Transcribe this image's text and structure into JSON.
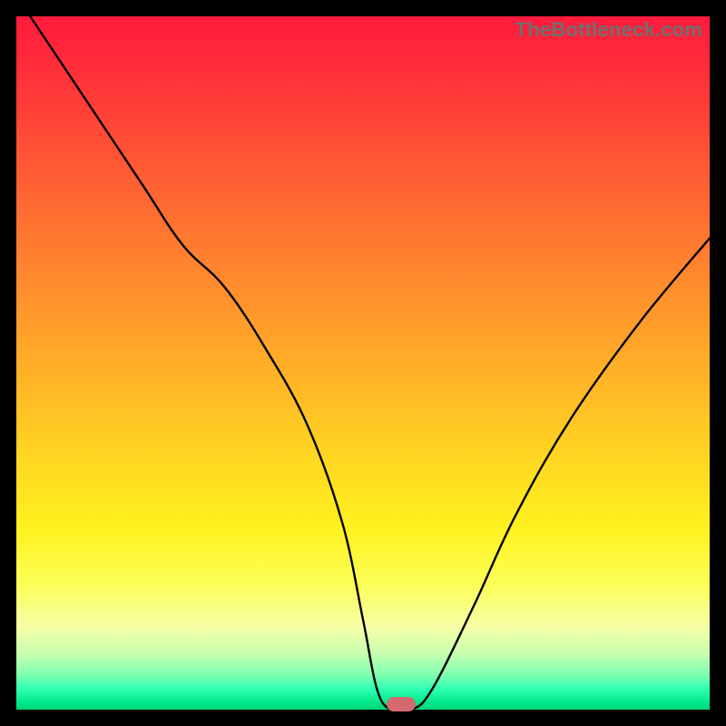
{
  "watermark": "TheBottleneck.com",
  "chart_data": {
    "type": "line",
    "title": "",
    "xlabel": "",
    "ylabel": "",
    "xlim": [
      0,
      100
    ],
    "ylim": [
      0,
      100
    ],
    "series": [
      {
        "name": "bottleneck-curve",
        "x": [
          2,
          10,
          18,
          24,
          30,
          36,
          42,
          47,
          50,
          52,
          54,
          57,
          60,
          66,
          72,
          80,
          90,
          100
        ],
        "values": [
          100,
          88,
          76,
          67,
          61,
          52,
          41,
          27,
          13,
          3,
          0,
          0,
          3,
          15,
          28,
          42,
          56,
          68
        ]
      }
    ],
    "annotations": [
      {
        "name": "optimal-marker",
        "x": 55.5,
        "y": 0
      }
    ],
    "gradient_stops": [
      {
        "pos": 0,
        "color": "#ff1a3c"
      },
      {
        "pos": 22,
        "color": "#ff5a34"
      },
      {
        "pos": 52,
        "color": "#ffb327"
      },
      {
        "pos": 74,
        "color": "#fff21f"
      },
      {
        "pos": 92,
        "color": "#c7ffb0"
      },
      {
        "pos": 100,
        "color": "#00d47a"
      }
    ]
  }
}
